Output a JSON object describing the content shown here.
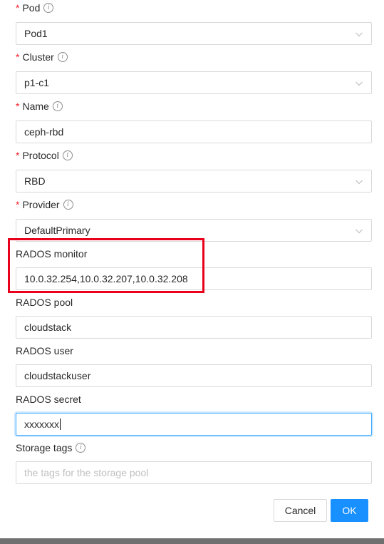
{
  "form": {
    "pod": {
      "label": "Pod",
      "required_mark": "*",
      "value": "Pod1"
    },
    "cluster": {
      "label": "Cluster",
      "required_mark": "*",
      "value": "p1-c1"
    },
    "name": {
      "label": "Name",
      "required_mark": "*",
      "value": "ceph-rbd"
    },
    "protocol": {
      "label": "Protocol",
      "required_mark": "*",
      "value": "RBD"
    },
    "provider": {
      "label": "Provider",
      "required_mark": "*",
      "value": "DefaultPrimary"
    },
    "rados_monitor": {
      "label": "RADOS monitor",
      "value": "10.0.32.254,10.0.32.207,10.0.32.208"
    },
    "rados_pool": {
      "label": "RADOS pool",
      "value": "cloudstack"
    },
    "rados_user": {
      "label": "RADOS user",
      "value": "cloudstackuser"
    },
    "rados_secret": {
      "label": "RADOS secret",
      "value": "xxxxxxx"
    },
    "storage_tags": {
      "label": "Storage tags",
      "value": "",
      "placeholder": "the tags for the storage pool"
    }
  },
  "footer": {
    "cancel_label": "Cancel",
    "ok_label": "OK"
  },
  "info_glyph": "i",
  "icons": {
    "info": "info-circle-icon",
    "dropdown": "chevron-down-icon"
  },
  "colors": {
    "required": "#f5222d",
    "primary": "#1890ff",
    "focus_border": "#40a9ff",
    "highlight_box": "#e8001c"
  }
}
